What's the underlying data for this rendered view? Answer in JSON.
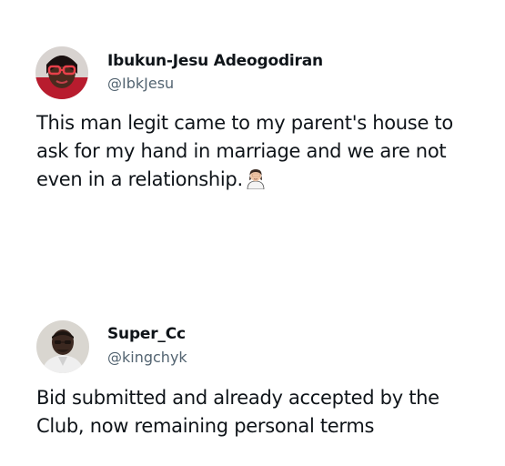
{
  "tweets": [
    {
      "author": {
        "name": "Ibukun-Jesu Adeogodiran",
        "handle": "@IbkJesu",
        "avatar_icon": "profile-photo"
      },
      "text": "This man legit came to my parent's house to ask for my hand in marriage and we are not even in a relationship.",
      "emoji_icon": "woman-facepalming-emoji"
    },
    {
      "author": {
        "name": "Super_Cc",
        "handle": "@kingchyk",
        "avatar_icon": "profile-photo"
      },
      "text": "Bid submitted and already accepted by the Club, now remaining personal terms"
    }
  ]
}
